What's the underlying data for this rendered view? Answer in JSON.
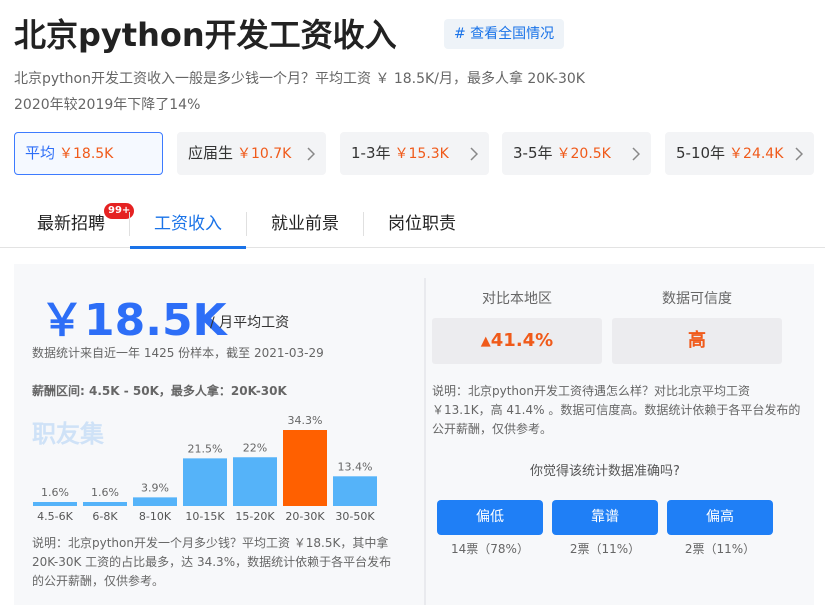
{
  "header": {
    "title": "北京python开发工资收入",
    "tag": "# 查看全国情况"
  },
  "description": {
    "line1": "北京python开发工资收入一般是多少钱一个月？平均工资 ￥ 18.5K/月，最多人拿 20K-30K",
    "line2": "2020年较2019年下降了14%"
  },
  "pills": [
    {
      "label": "平均",
      "value": "￥18.5K",
      "active": true
    },
    {
      "label": "应届生",
      "value": "￥10.7K",
      "active": false
    },
    {
      "label": "1-3年",
      "value": "￥15.3K",
      "active": false
    },
    {
      "label": "3-5年",
      "value": "￥20.5K",
      "active": false
    },
    {
      "label": "5-10年",
      "value": "￥24.4K",
      "active": false
    }
  ],
  "tabs": [
    {
      "label": "最新招聘",
      "badge": "99+"
    },
    {
      "label": "工资收入"
    },
    {
      "label": "就业前景"
    },
    {
      "label": "岗位职责"
    }
  ],
  "salary": {
    "big_value": "￥18.5K",
    "unit": "/ 月平均工资",
    "sample": "数据统计来自近一年 1425 份样本，截至 2021-03-29",
    "range": "薪酬区间: 4.5K - 50K，最多人拿：20K-30K",
    "watermark": "职友集"
  },
  "chart_data": {
    "type": "bar",
    "categories": [
      "4.5-6K",
      "6-8K",
      "8-10K",
      "10-15K",
      "15-20K",
      "20-30K",
      "30-50K"
    ],
    "values": [
      1.6,
      1.6,
      3.9,
      21.5,
      22,
      34.3,
      13.4
    ],
    "labels": [
      "1.6%",
      "1.6%",
      "3.9%",
      "21.5%",
      "22%",
      "34.3%",
      "13.4%"
    ],
    "highlight_index": 5,
    "colors": {
      "normal": "#55b3f9",
      "highlight": "#ff6000"
    }
  },
  "note_left": "说明：北京python开发一个月多少钱？平均工资 ￥18.5K，其中拿 20K-30K 工资的占比最多，达 34.3%，数据统计依赖于各平台发布的公开薪酬，仅供参考。",
  "compare": {
    "local_head": "对比本地区",
    "local_value": "41.4%",
    "trust_head": "数据可信度",
    "trust_value": "高"
  },
  "note_right": "说明：北京python开发工资待遇怎么样？对比北京平均工资 ￥13.1K，高 41.4% 。数据可信度高。数据统计依赖于各平台发布的公开薪酬，仅供参考。",
  "question": "你觉得该统计数据准确吗?",
  "votes": [
    {
      "label": "偏低",
      "count": "14票（78%）"
    },
    {
      "label": "靠谱",
      "count": "2票（11%）"
    },
    {
      "label": "偏高",
      "count": "2票（11%）"
    }
  ],
  "colors": {
    "accent": "#1a73e8",
    "orange": "#f05a1a",
    "button": "#1f7ff6"
  }
}
